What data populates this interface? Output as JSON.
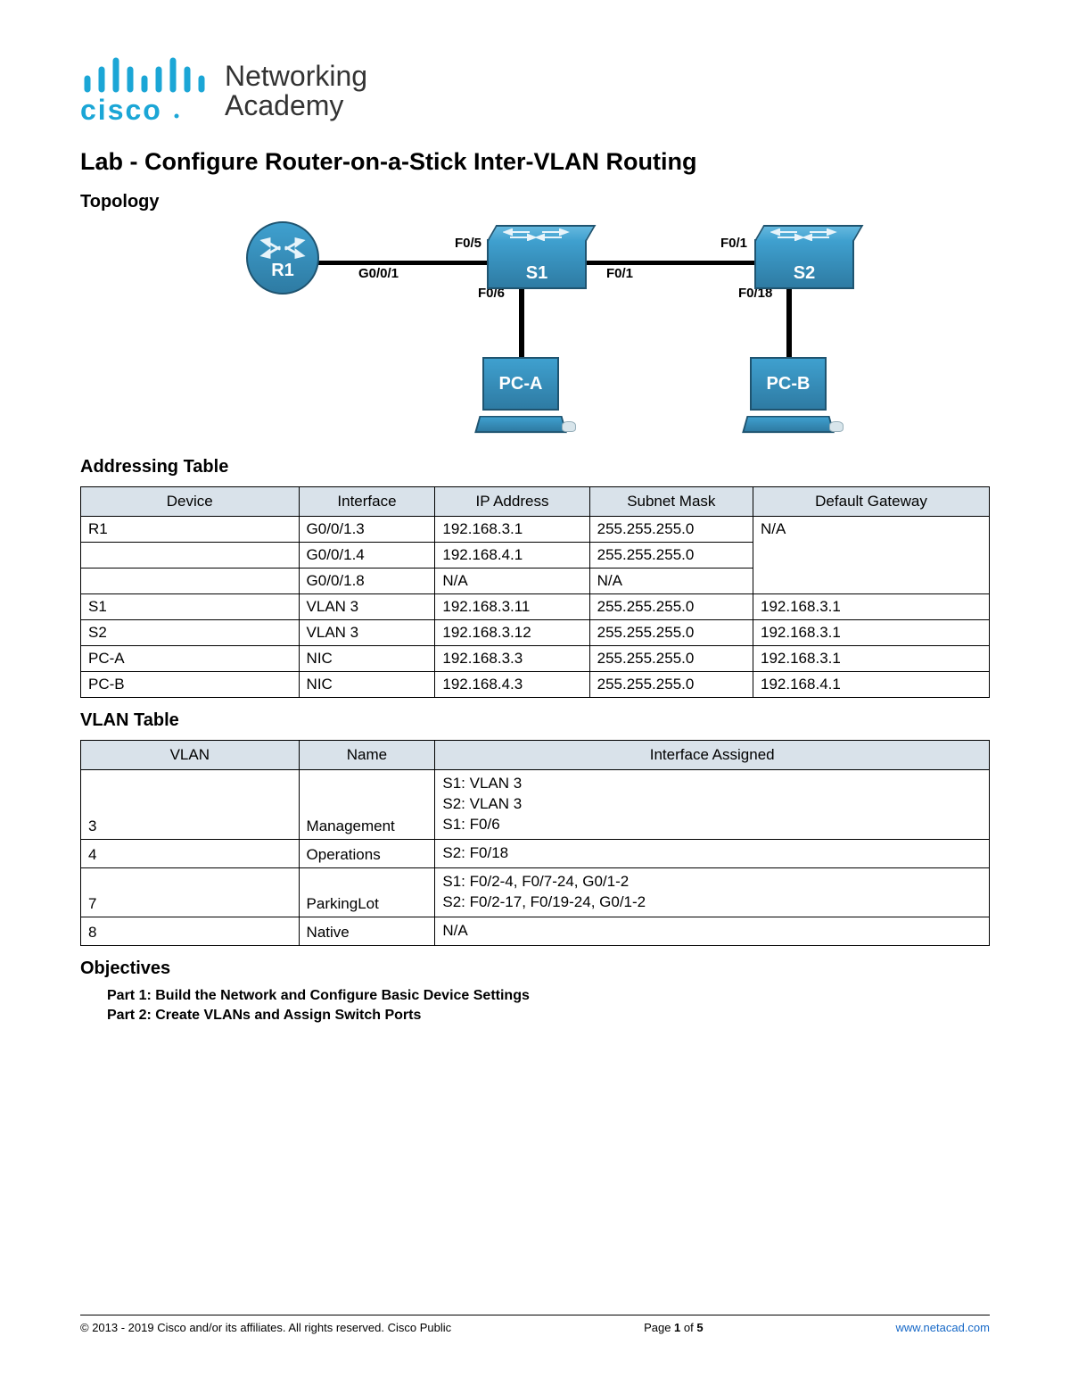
{
  "logo": {
    "brand": "cisco",
    "line1": "Networking",
    "line2": "Academy"
  },
  "title": "Lab - Configure Router-on-a-Stick Inter-VLAN Routing",
  "sections": {
    "topology": "Topology",
    "addressing": "Addressing Table",
    "vlan": "VLAN Table",
    "objectives": "Objectives"
  },
  "topology": {
    "devices": {
      "r1": "R1",
      "s1": "S1",
      "s2": "S2",
      "pca": "PC-A",
      "pcb": "PC-B"
    },
    "ports": {
      "r1_s1_router": "G0/0/1",
      "r1_s1_switch": "F0/5",
      "s1_pca": "F0/6",
      "s1_s2_left": "F0/1",
      "s1_s2_right": "F0/1",
      "s2_pcb": "F0/18"
    }
  },
  "addressing_table": {
    "headers": [
      "Device",
      "Interface",
      "IP Address",
      "Subnet Mask",
      "Default Gateway"
    ],
    "rows": [
      {
        "device": "R1",
        "interface": "G0/0/1.3",
        "ip": "192.168.3.1",
        "mask": "255.255.255.0",
        "gw": "N/A",
        "device_rowspan": 1,
        "gw_rowspan": 3
      },
      {
        "device": "",
        "interface": "G0/0/1.4",
        "ip": "192.168.4.1",
        "mask": "255.255.255.0"
      },
      {
        "device": "",
        "interface": "G0/0/1.8",
        "ip": "N/A",
        "mask": "N/A"
      },
      {
        "device": "S1",
        "interface": "VLAN 3",
        "ip": "192.168.3.11",
        "mask": "255.255.255.0",
        "gw": "192.168.3.1"
      },
      {
        "device": "S2",
        "interface": "VLAN 3",
        "ip": "192.168.3.12",
        "mask": "255.255.255.0",
        "gw": "192.168.3.1"
      },
      {
        "device": "PC-A",
        "interface": "NIC",
        "ip": "192.168.3.3",
        "mask": "255.255.255.0",
        "gw": "192.168.3.1"
      },
      {
        "device": "PC-B",
        "interface": "NIC",
        "ip": "192.168.4.3",
        "mask": "255.255.255.0",
        "gw": "192.168.4.1"
      }
    ]
  },
  "vlan_table": {
    "headers": [
      "VLAN",
      "Name",
      "Interface Assigned"
    ],
    "rows": [
      {
        "vlan": "3",
        "name": "Management",
        "assigned": [
          "S1: VLAN 3",
          "S2: VLAN 3",
          "S1: F0/6"
        ]
      },
      {
        "vlan": "4",
        "name": "Operations",
        "assigned": [
          "S2: F0/18"
        ]
      },
      {
        "vlan": "7",
        "name": "ParkingLot",
        "assigned": [
          "S1: F0/2-4, F0/7-24, G0/1-2",
          "S2: F0/2-17, F0/19-24, G0/1-2"
        ]
      },
      {
        "vlan": "8",
        "name": "Native",
        "assigned": [
          "N/A"
        ]
      }
    ]
  },
  "objectives": [
    "Part 1: Build the Network and Configure Basic Device Settings",
    "Part 2: Create VLANs and Assign Switch Ports"
  ],
  "footer": {
    "copyright": "© 2013 - 2019 Cisco and/or its affiliates. All rights reserved. Cisco Public",
    "page_label": "Page ",
    "page_num": "1",
    "page_of": " of ",
    "page_total": "5",
    "url": "www.netacad.com"
  }
}
